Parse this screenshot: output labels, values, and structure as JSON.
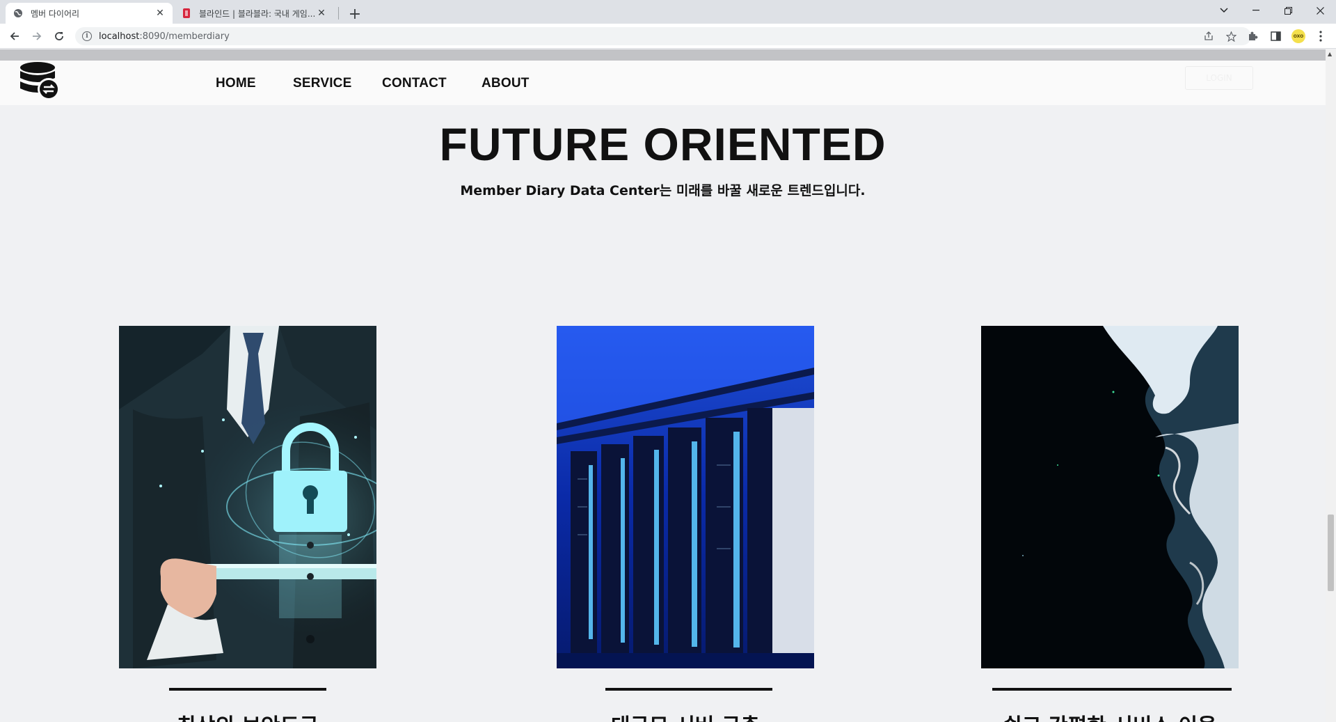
{
  "browser": {
    "tabs": [
      {
        "title": "멤버 다이어리",
        "active": true
      },
      {
        "title": "블라인드 | 블라블라: 국내 게임..."
      }
    ],
    "url_host": "localhost",
    "url_path": ":8090/memberdiary",
    "profile_label": "OXO"
  },
  "site": {
    "nav": [
      "HOME",
      "SERVICE",
      "CONTACT",
      "ABOUT"
    ],
    "login_label": "LOGIN"
  },
  "hero": {
    "title": "FUTURE ORIENTED",
    "subtitle": "Member Diary Data Center는 미래를 바꿀 새로운 트렌드입니다."
  },
  "cards": [
    {
      "title": "최상의 보안도구",
      "image": "security-lock-image"
    },
    {
      "title": "대규모 서버 구축",
      "image": "server-room-image"
    },
    {
      "title": "쉽고 간편한 서비스 이용",
      "image": "ocean-shore-image"
    }
  ],
  "colors": {
    "page_bg": "#f0f1f3",
    "text": "#111111",
    "chrome_bg": "#dee1e6"
  }
}
